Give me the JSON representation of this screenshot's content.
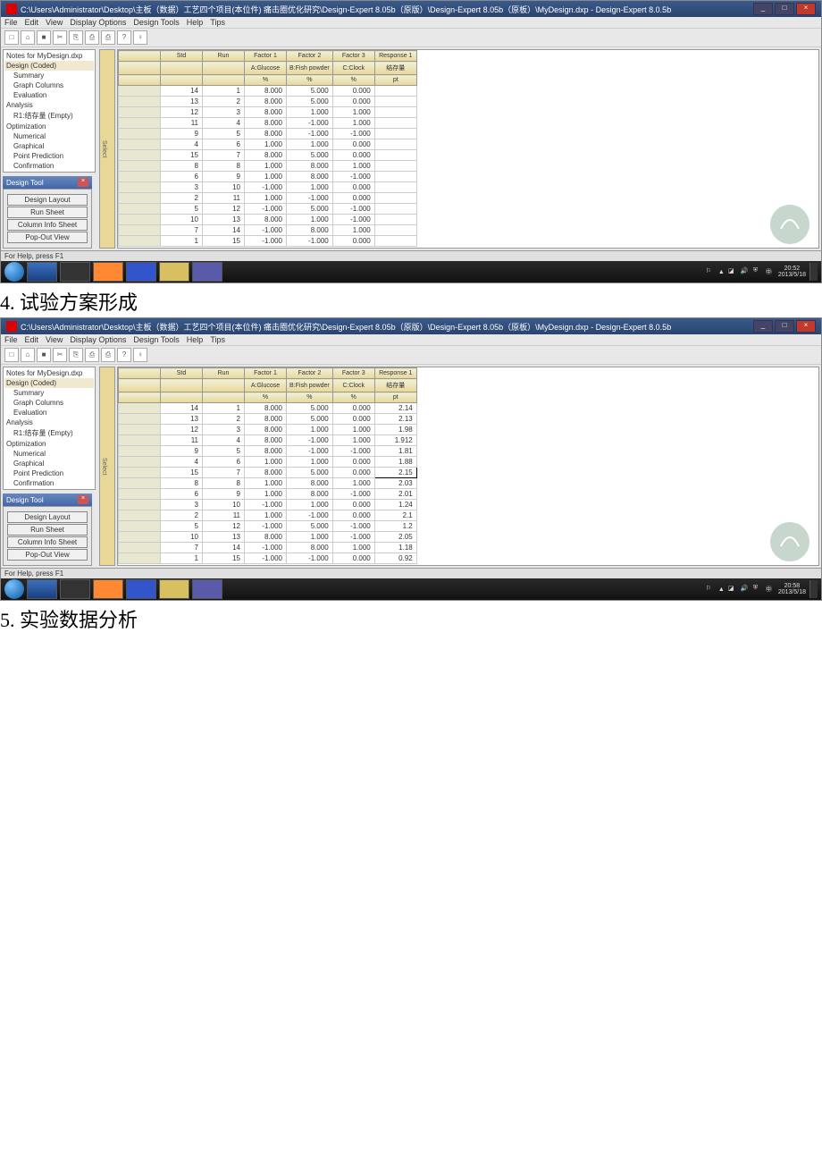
{
  "shot1": {
    "titlebar": "C:\\Users\\Administrator\\Desktop\\主板（数据）工艺四个项目(本位件)  痛击圈优化研究\\Design-Expert 8.05b（原版）\\Design-Expert 8.05b（原板）\\MyDesign.dxp - Design-Expert 8.0.5b",
    "menus": [
      "File",
      "Edit",
      "View",
      "Display Options",
      "Design Tools",
      "Help",
      "Tips"
    ],
    "tree": [
      {
        "t": "Notes for MyDesign.dxp",
        "c": "",
        "i": 0
      },
      {
        "t": "Design (Coded)",
        "c": "sel",
        "i": 0
      },
      {
        "t": "Summary",
        "c": "",
        "i": 1
      },
      {
        "t": "Graph Columns",
        "c": "",
        "i": 1
      },
      {
        "t": "Evaluation",
        "c": "",
        "i": 1
      },
      {
        "t": "Analysis",
        "c": "",
        "i": 0
      },
      {
        "t": "R1:结存量 (Empty)",
        "c": "",
        "i": 1
      },
      {
        "t": "Optimization",
        "c": "",
        "i": 0
      },
      {
        "t": "Numerical",
        "c": "",
        "i": 1
      },
      {
        "t": "Graphical",
        "c": "",
        "i": 1
      },
      {
        "t": "Point Prediction",
        "c": "",
        "i": 1
      },
      {
        "t": "Confirmation",
        "c": "",
        "i": 1
      }
    ],
    "sidetab": "Select",
    "headers": [
      [
        "",
        "Std",
        "Run",
        "Factor 1",
        "Factor 2",
        "Factor 3",
        "Response 1"
      ],
      [
        "",
        "",
        "",
        "A:Glucose",
        "B:Fish powder",
        "C:Clock",
        "结存量"
      ],
      [
        "",
        "",
        "",
        "%",
        "%",
        "%",
        "pt"
      ]
    ],
    "rows": [
      [
        "",
        "14",
        "1",
        "8.000",
        "5.000",
        "0.000",
        ""
      ],
      [
        "",
        "13",
        "2",
        "8.000",
        "5.000",
        "0.000",
        ""
      ],
      [
        "",
        "12",
        "3",
        "8.000",
        "1.000",
        "1.000",
        ""
      ],
      [
        "",
        "11",
        "4",
        "8.000",
        "-1.000",
        "1.000",
        ""
      ],
      [
        "",
        "9",
        "5",
        "8.000",
        "-1.000",
        "-1.000",
        ""
      ],
      [
        "",
        "4",
        "6",
        "1.000",
        "1.000",
        "0.000",
        ""
      ],
      [
        "",
        "15",
        "7",
        "8.000",
        "5.000",
        "0.000",
        ""
      ],
      [
        "",
        "8",
        "8",
        "1.000",
        "8.000",
        "1.000",
        ""
      ],
      [
        "",
        "6",
        "9",
        "1.000",
        "8.000",
        "-1.000",
        ""
      ],
      [
        "",
        "3",
        "10",
        "-1.000",
        "1.000",
        "0.000",
        ""
      ],
      [
        "",
        "2",
        "11",
        "1.000",
        "-1.000",
        "0.000",
        ""
      ],
      [
        "",
        "5",
        "12",
        "-1.000",
        "5.000",
        "-1.000",
        ""
      ],
      [
        "",
        "10",
        "13",
        "8.000",
        "1.000",
        "-1.000",
        ""
      ],
      [
        "",
        "7",
        "14",
        "-1.000",
        "8.000",
        "1.000",
        ""
      ],
      [
        "",
        "1",
        "15",
        "-1.000",
        "-1.000",
        "0.000",
        ""
      ]
    ],
    "dtool": {
      "title": "Design Tool",
      "buttons": [
        "Design Layout",
        "Run Sheet",
        "Column Info Sheet",
        "Pop-Out View"
      ]
    },
    "status": "For Help, press F1",
    "clock": {
      "t": "20:52",
      "d": "2013/5/18"
    }
  },
  "shot2": {
    "titlebar": "C:\\Users\\Administrator\\Desktop\\主板（数据）工艺四个项目(本位件)  痛击圈优化研究\\Design-Expert 8.05b（原版）\\Design-Expert 8.05b（原板）\\MyDesign.dxp - Design-Expert 8.0.5b",
    "headers": [
      [
        "",
        "Std",
        "Run",
        "Factor 1",
        "Factor 2",
        "Factor 3",
        "Response 1"
      ],
      [
        "",
        "",
        "",
        "A:Glucose",
        "B:Fish powder",
        "C:Clock",
        "结存量"
      ],
      [
        "",
        "",
        "",
        "%",
        "%",
        "%",
        "pt"
      ]
    ],
    "rows": [
      [
        "",
        "14",
        "1",
        "8.000",
        "5.000",
        "0.000",
        "2.14"
      ],
      [
        "",
        "13",
        "2",
        "8.000",
        "5.000",
        "0.000",
        "2.13"
      ],
      [
        "",
        "12",
        "3",
        "8.000",
        "1.000",
        "1.000",
        "1.98"
      ],
      [
        "",
        "11",
        "4",
        "8.000",
        "-1.000",
        "1.000",
        "1.912"
      ],
      [
        "",
        "9",
        "5",
        "8.000",
        "-1.000",
        "-1.000",
        "1.81"
      ],
      [
        "",
        "4",
        "6",
        "1.000",
        "1.000",
        "0.000",
        "1.88"
      ],
      [
        "",
        "15",
        "7",
        "8.000",
        "5.000",
        "0.000",
        "2.15"
      ],
      [
        "",
        "8",
        "8",
        "1.000",
        "8.000",
        "1.000",
        "2.03"
      ],
      [
        "",
        "6",
        "9",
        "1.000",
        "8.000",
        "-1.000",
        "2.01"
      ],
      [
        "",
        "3",
        "10",
        "-1.000",
        "1.000",
        "0.000",
        "1.24"
      ],
      [
        "",
        "2",
        "11",
        "1.000",
        "-1.000",
        "0.000",
        "2.1"
      ],
      [
        "",
        "5",
        "12",
        "-1.000",
        "5.000",
        "-1.000",
        "1.2"
      ],
      [
        "",
        "10",
        "13",
        "8.000",
        "1.000",
        "-1.000",
        "2.05"
      ],
      [
        "",
        "7",
        "14",
        "-1.000",
        "8.000",
        "1.000",
        "1.18"
      ],
      [
        "",
        "1",
        "15",
        "-1.000",
        "-1.000",
        "0.000",
        "0.92"
      ]
    ],
    "selcell": "2.15",
    "clock": {
      "t": "20:58",
      "d": "2013/5/18"
    }
  },
  "caption1": "4. 试验方案形成",
  "caption2": "5. 实验数据分析"
}
